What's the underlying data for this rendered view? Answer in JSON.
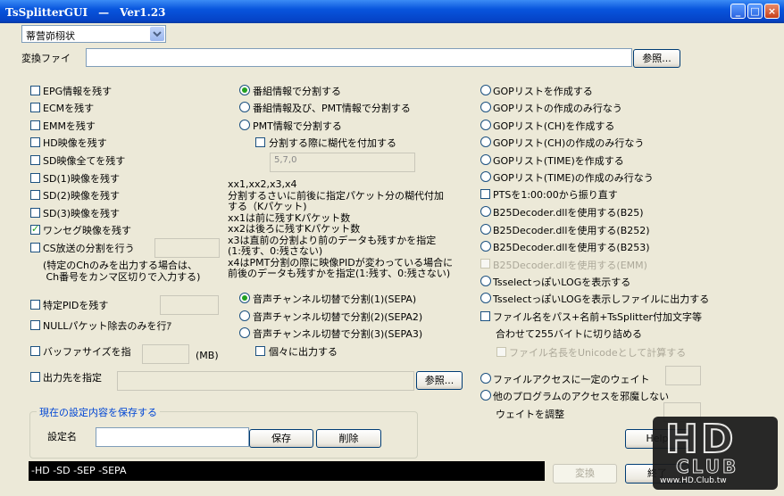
{
  "window": {
    "title": "TsSplitterGUI　—　Ver1.23",
    "minimize_label": "_",
    "maximize_label": "□",
    "close_label": "×"
  },
  "preset": {
    "value": "蒂营峁栩状"
  },
  "input_file": {
    "label": "変換ファイ",
    "value": "",
    "browse": "参照..."
  },
  "col1": {
    "epg": "EPG情報を残す",
    "ecm": "ECMを残す",
    "emm": "EMMを残す",
    "hd": "HD映像を残す",
    "sd_all": "SD映像全てを残す",
    "sd1": "SD(1)映像を残す",
    "sd2": "SD(2)映像を残す",
    "sd3": "SD(3)映像を残す",
    "oneseg": "ワンセグ映像を残す",
    "cs_split": "CS放送の分割を行う",
    "cs_note": "(特定のChのみを出力する場合は、\n Ch番号をカンマ区切りで入力する)",
    "pid": "特定PIDを残す",
    "null": "NULLパケット除去のみを行ｱ",
    "buffer": "バッファサイズを指",
    "buffer_unit": "(MB)",
    "output": "出力先を指定",
    "output_browse": "参照..."
  },
  "col2": {
    "split_program": "番組情報で分割する",
    "split_program_pmt": "番組情報及び、PMT情報で分割する",
    "split_pmt": "PMT情報で分割する",
    "add_sidetext": "分割する際に糊代を付加する",
    "sidetext_value": "5,7,0",
    "help_text": "xx1,xx2,x3,x4\n分割するさいに前後に指定パケット分の糊代付加\nする（Kパケット)\nxx1は前に残すKパケット数\nxx2は後ろに残すKパケット数\nx3は直前の分割より前のデータも残すかを指定\n(1:残す、0:残さない)\nx4はPMT分割の際に映像PIDが変わっている場合に\n前後のデータも残すかを指定(1:残す、0:残さない)",
    "sepa1": "音声チャンネル切替で分割(1)(SEPA)",
    "sepa2": "音声チャンネル切替で分割(2)(SEPA2)",
    "sepa3": "音声チャンネル切替で分割(3)(SEPA3)",
    "separate_out": "個々に出力する"
  },
  "col3": {
    "gop": "GOPリストを作成する",
    "gop_only": "GOPリストの作成のみ行なう",
    "gop_ch": "GOPリスト(CH)を作成する",
    "gop_ch_only": "GOPリスト(CH)の作成のみ行なう",
    "gop_time": "GOPリスト(TIME)を作成する",
    "gop_time_only": "GOPリスト(TIME)の作成のみ行なう",
    "pts": "PTSを1:00:00から振り直す",
    "b25": "B25Decoder.dllを使用する(B25)",
    "b252": "B25Decoder.dllを使用する(B252)",
    "b253": "B25Decoder.dllを使用する(B253)",
    "emm_dis": "B25Decoder.dllを使用する(EMM)",
    "tsselect": "TsselectっぽいLOGを表示する",
    "tsselect_file": "TsselectっぽいLOGを表示しファイルに出力する",
    "filename": "ファイル名をパス+名前+TsSplitter付加文字等",
    "filename2": "合わせて255バイトに切り詰める",
    "unicode": "ファイル名長をUnicodeとして計算する",
    "access_wait": "ファイルアクセスに一定のウェイト",
    "no_disturb": "他のプログラムのアクセスを邪魔しない",
    "wait_adjust": "ウェイトを調整"
  },
  "save_group": {
    "title": "現在の設定内容を保存する",
    "name_label": "設定名",
    "save": "保存",
    "delete": "削除"
  },
  "status": {
    "command": "-HD -SD -SEP -SEPA"
  },
  "buttons": {
    "help": "Help",
    "convert": "変換",
    "exit": "終了"
  },
  "watermark": {
    "logo": "HD CLUB",
    "url": "www.HD.Club.tw"
  }
}
